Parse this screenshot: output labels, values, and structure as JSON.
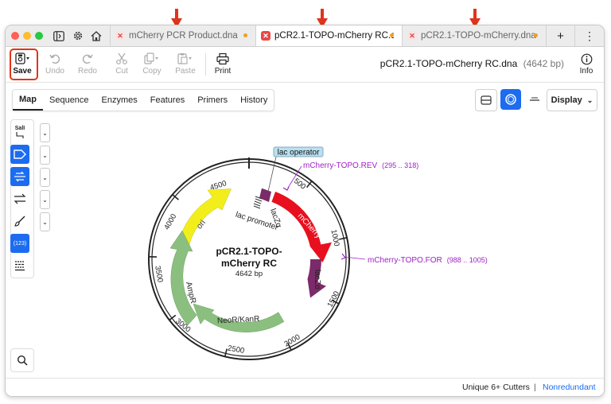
{
  "tabs": [
    {
      "label": "mCherry PCR Product.dna",
      "active": false,
      "modified": true
    },
    {
      "label": "pCR2.1-TOPO-mCherry RC.dna",
      "active": true,
      "modified": true
    },
    {
      "label": "pCR2.1-TOPO-mCherry.dna",
      "active": false,
      "modified": true
    }
  ],
  "tabbar": {
    "new_tab": "+",
    "more": "⋮"
  },
  "toolbar": {
    "save": "Save",
    "undo": "Undo",
    "redo": "Redo",
    "cut": "Cut",
    "copy": "Copy",
    "paste": "Paste",
    "print": "Print",
    "info": "Info",
    "doc_title": "pCR2.1-TOPO-mCherry RC.dna",
    "doc_length": "(4642 bp)"
  },
  "view_tabs": [
    "Map",
    "Sequence",
    "Enzymes",
    "Features",
    "Primers",
    "History"
  ],
  "active_view": "Map",
  "display_menu": "Display",
  "sidebar": {
    "enzyme_label": "SalI",
    "numbers_label": "(123)"
  },
  "map": {
    "name_line1": "pCR2.1-TOPO-",
    "name_line2": "mCherry RC",
    "size": "4642 bp",
    "ticks": [
      "500",
      "1000",
      "1500",
      "2000",
      "2500",
      "3000",
      "3500",
      "4000",
      "4500"
    ],
    "features": {
      "lac_operator": "lac operator",
      "lac_promoter": "lac promoter",
      "lacZa_top": "lacZα",
      "mcherry": "mCherry",
      "lacZa_side": "lacZα",
      "ori": "ori",
      "ampr": "AmpR",
      "neor": "NeoR/KanR"
    },
    "primers": [
      {
        "name": "mCherry-TOPO.REV",
        "range": "(295 .. 318)"
      },
      {
        "name": "mCherry-TOPO.FOR",
        "range": "(988 .. 1005)"
      }
    ]
  },
  "status": {
    "cutters": "Unique 6+ Cutters",
    "separator": "|",
    "mode": "Nonredundant"
  },
  "colors": {
    "accent": "#1d6cf0",
    "highlight": "#e0341a",
    "mcherry": "#e8101e",
    "ori": "#f2ee1c",
    "marker": "#7b2a6a",
    "resistance": "#8bbf7f",
    "primer": "#a020c8"
  }
}
